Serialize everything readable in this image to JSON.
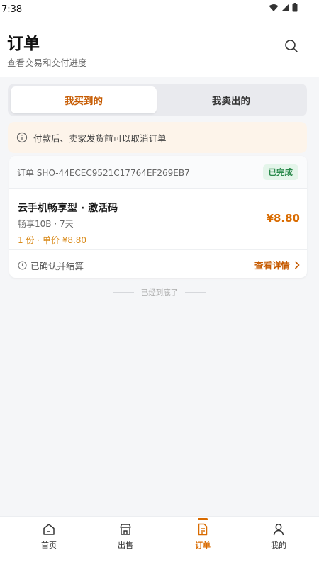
{
  "status_bar": {
    "time": "7:38"
  },
  "header": {
    "title": "订单",
    "subtitle": "查看交易和交付进度",
    "search_icon": "search-icon"
  },
  "tabs": [
    {
      "label": "我买到的",
      "active": true
    },
    {
      "label": "我卖出的",
      "active": false
    }
  ],
  "notice": {
    "text": "付款后、卖家发货前可以取消订单",
    "icon": "info-icon"
  },
  "order": {
    "id_text": "订单 SHO-44ECEC9521C17764EF269EB7",
    "status": "已完成",
    "product_name": "云手机畅享型 · 激活码",
    "spec": "畅享10B · 7天",
    "qty_price": "1 份 · 单价 ¥8.80",
    "total": "¥8.80",
    "settle_text": "已确认并结算",
    "details_label": "查看详情"
  },
  "list_end_text": "已经到底了",
  "nav": [
    {
      "label": "首页",
      "icon": "home-icon",
      "active": false
    },
    {
      "label": "出售",
      "icon": "store-icon",
      "active": false
    },
    {
      "label": "订单",
      "icon": "document-icon",
      "active": true
    },
    {
      "label": "我的",
      "icon": "user-icon",
      "active": false
    }
  ],
  "colors": {
    "accent": "#d96b00",
    "success": "#2a8a4c",
    "notice_bg": "#fdf4ea"
  }
}
